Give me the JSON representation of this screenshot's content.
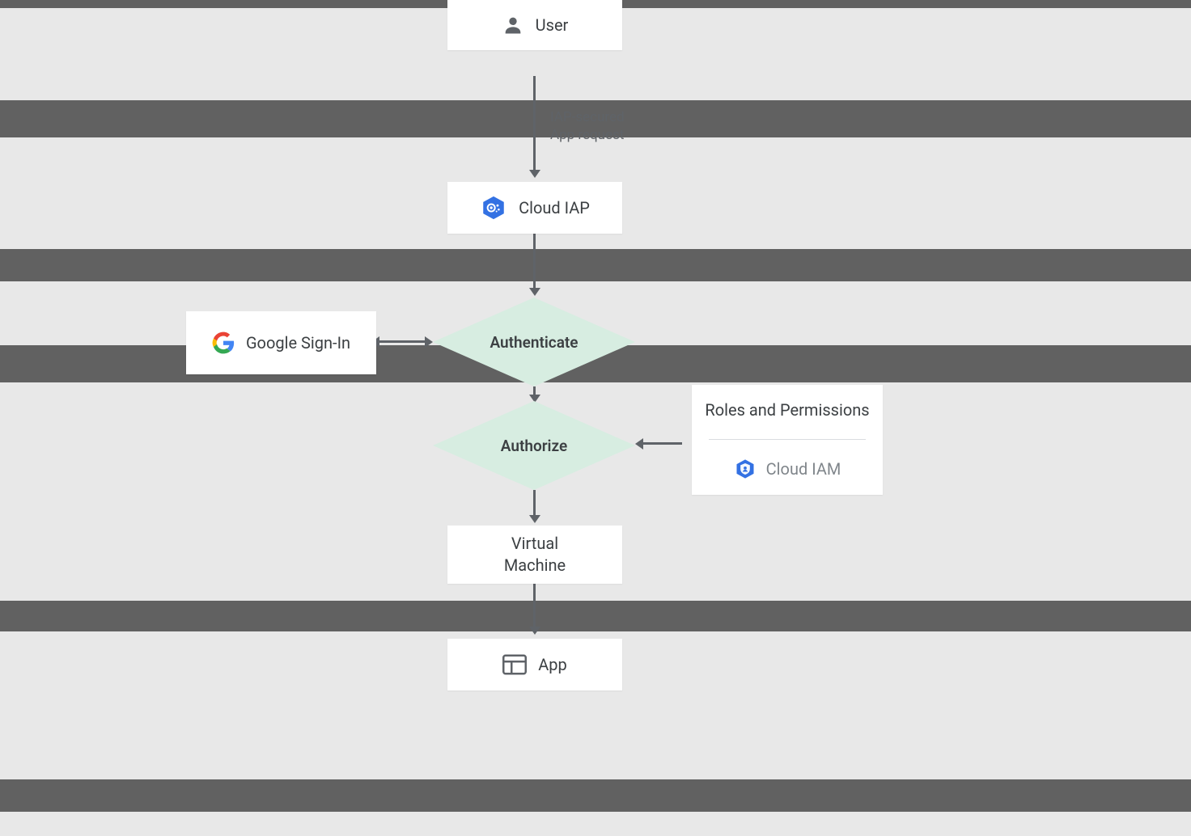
{
  "nodes": {
    "user": "User",
    "iap": "Cloud IAP",
    "signin": "Google Sign-In",
    "authenticate": "Authenticate",
    "authorize": "Authorize",
    "vm": "Virtual\nMachine",
    "app": "App",
    "roles_title": "Roles and Permissions",
    "iam": "Cloud IAM"
  },
  "edges": {
    "request": "IAP-secured\nApp request"
  },
  "chart_data": {
    "type": "flow",
    "nodes": [
      {
        "id": "user",
        "label": "User"
      },
      {
        "id": "iap",
        "label": "Cloud IAP"
      },
      {
        "id": "signin",
        "label": "Google Sign-In"
      },
      {
        "id": "auth",
        "label": "Authenticate",
        "shape": "decision"
      },
      {
        "id": "authz",
        "label": "Authorize",
        "shape": "decision"
      },
      {
        "id": "roles",
        "label": "Roles and Permissions / Cloud IAM"
      },
      {
        "id": "vm",
        "label": "Virtual Machine"
      },
      {
        "id": "app",
        "label": "App"
      }
    ],
    "edges": [
      {
        "from": "user",
        "to": "iap",
        "label": "IAP-secured App request"
      },
      {
        "from": "iap",
        "to": "auth"
      },
      {
        "from": "signin",
        "to": "auth",
        "bidir": true
      },
      {
        "from": "auth",
        "to": "authz"
      },
      {
        "from": "roles",
        "to": "authz"
      },
      {
        "from": "authz",
        "to": "vm"
      },
      {
        "from": "vm",
        "to": "app"
      }
    ]
  }
}
